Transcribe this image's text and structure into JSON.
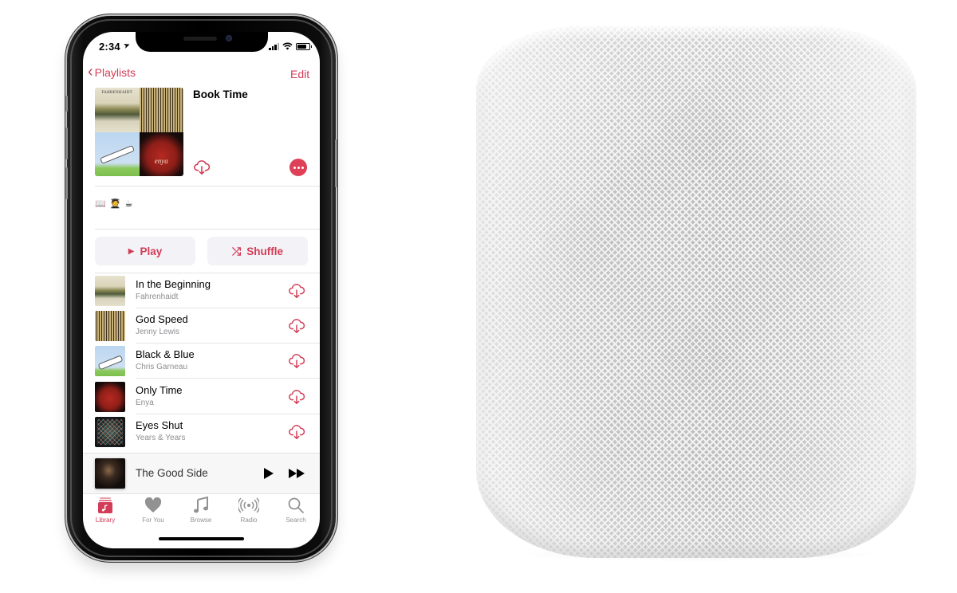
{
  "status_bar": {
    "time": "2:34",
    "location_glyph": "➤"
  },
  "nav": {
    "back_label": "Playlists",
    "edit_label": "Edit"
  },
  "playlist": {
    "title": "Book Time",
    "description": "📖 🧑‍🎓 ☕",
    "artwork_tiles": [
      "Fahrenhaidt",
      "Jenny Lewis",
      "Chris Garneau",
      "Enya"
    ],
    "artwork_text": {
      "fahrenhaidt": "FAHRENHAIDT",
      "enya": "enya"
    },
    "icons": {
      "download": "cloud-download-icon",
      "more": "more-icon"
    }
  },
  "actions": {
    "play": {
      "label": "Play",
      "glyph": "▶"
    },
    "shuffle": {
      "label": "Shuffle",
      "glyph": "⤮"
    }
  },
  "tracks": [
    {
      "title": "In the Beginning",
      "artist": "Fahrenhaidt",
      "art": "fahrenhaidt"
    },
    {
      "title": "God Speed",
      "artist": "Jenny Lewis",
      "art": "jenny"
    },
    {
      "title": "Black & Blue",
      "artist": "Chris Garneau",
      "art": "chris"
    },
    {
      "title": "Only Time",
      "artist": "Enya",
      "art": "enya"
    },
    {
      "title": "Eyes Shut",
      "artist": "Years & Years",
      "art": "years"
    }
  ],
  "now_playing": {
    "title": "The Good Side"
  },
  "tab_bar": {
    "items": [
      {
        "label": "Library",
        "icon": "library-icon",
        "active": true
      },
      {
        "label": "For You",
        "icon": "heart-icon",
        "active": false
      },
      {
        "label": "Browse",
        "icon": "music-note-icon",
        "active": false
      },
      {
        "label": "Radio",
        "icon": "radio-icon",
        "active": false
      },
      {
        "label": "Search",
        "icon": "search-icon",
        "active": false
      }
    ]
  },
  "colors": {
    "accent": "#d23c56",
    "more_button": "#dd4057",
    "button_bg": "#f3f2f6",
    "secondary_text": "#8e8e93",
    "tab_inactive": "#929292"
  },
  "product_image": {
    "name": "HomePod",
    "color": "white"
  }
}
